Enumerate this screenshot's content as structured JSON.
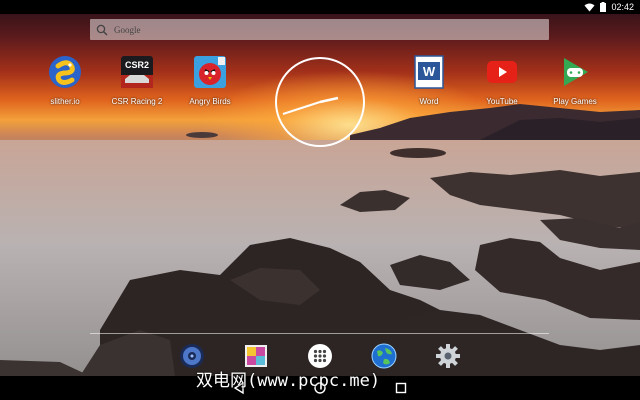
{
  "status_bar": {
    "time": "02:42"
  },
  "search": {
    "placeholder": "Google"
  },
  "apps": [
    {
      "label": "slither.io",
      "icon": "slither-io-icon"
    },
    {
      "label": "CSR Racing 2",
      "icon": "csr-racing-2-icon",
      "badge": "CSR2"
    },
    {
      "label": "Angry Birds",
      "icon": "angry-birds-icon"
    },
    {
      "label": "Word",
      "icon": "word-icon",
      "badge": "W"
    },
    {
      "label": "YouTube",
      "icon": "youtube-icon"
    },
    {
      "label": "Play Games",
      "icon": "play-games-icon"
    }
  ],
  "dock": [
    {
      "icon": "music-player-icon"
    },
    {
      "icon": "gallery-icon"
    },
    {
      "icon": "app-drawer-icon"
    },
    {
      "icon": "browser-globe-icon"
    },
    {
      "icon": "settings-gear-icon"
    }
  ],
  "watermark": "双电网(www.pcpc.me)",
  "colors": {
    "word": "#2b579a",
    "youtube": "#e62117",
    "play_games": "#34a853"
  }
}
